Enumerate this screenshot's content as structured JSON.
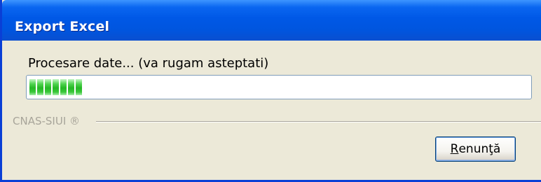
{
  "window": {
    "title": "Export Excel"
  },
  "progress": {
    "label": "Procesare date... (va rugam asteptati)",
    "value_percent": 11,
    "segments_filled": 7,
    "fill_color": "#25b825"
  },
  "footer": {
    "brand_label": "CNAS-SIUI ®"
  },
  "actions": {
    "cancel_label_mnemonic": "R",
    "cancel_label_rest": "enunţă"
  },
  "colors": {
    "titlebar": "#0058e6",
    "dialog_bg": "#ece9d8"
  }
}
